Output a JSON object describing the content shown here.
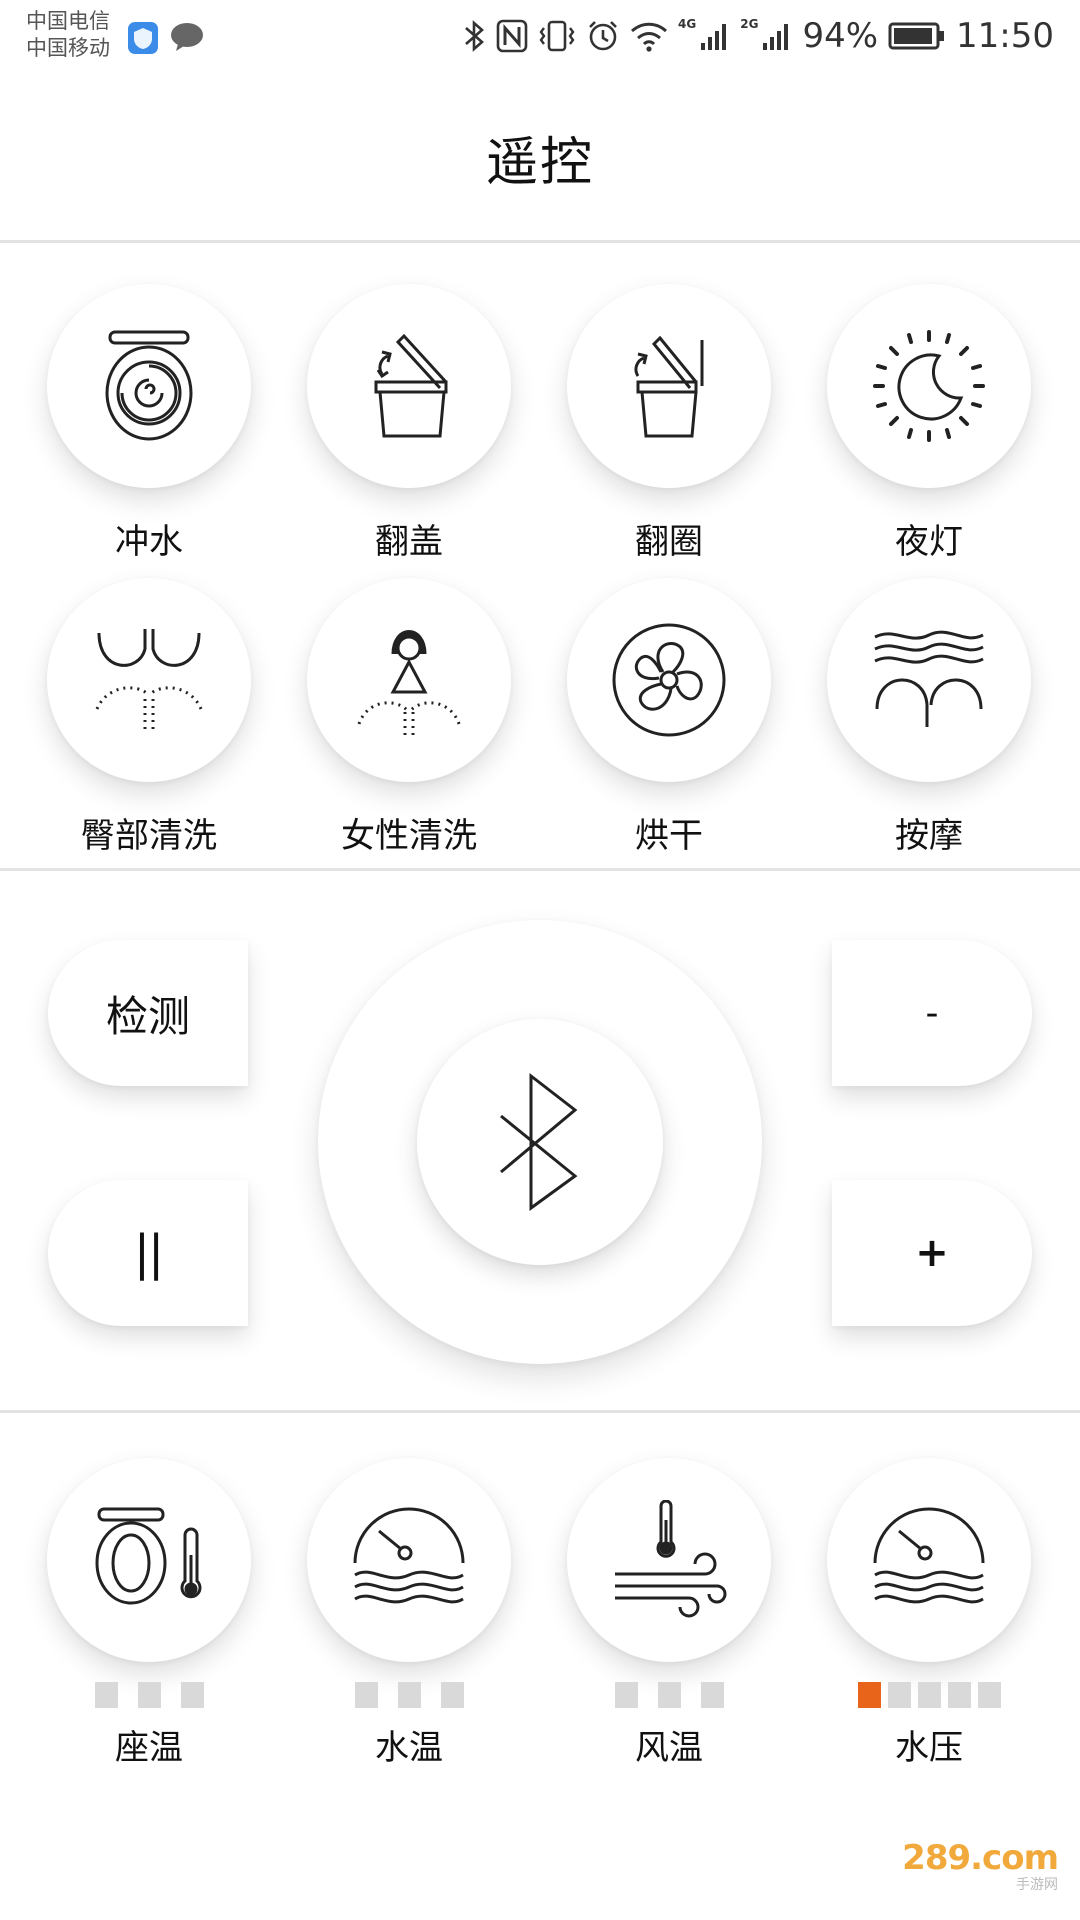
{
  "status_bar": {
    "carrier_1": "中国电信",
    "carrier_2": "中国移动",
    "net_4g": "4G",
    "net_2g": "2G",
    "battery": "94%",
    "time": "11:50"
  },
  "header": {
    "title": "遥控"
  },
  "functions": [
    {
      "label": "冲水",
      "icon": "flush-icon"
    },
    {
      "label": "翻盖",
      "icon": "lid-flip-icon"
    },
    {
      "label": "翻圈",
      "icon": "seat-ring-flip-icon"
    },
    {
      "label": "夜灯",
      "icon": "night-light-icon"
    },
    {
      "label": "臀部清洗",
      "icon": "rear-wash-icon"
    },
    {
      "label": "女性清洗",
      "icon": "feminine-wash-icon"
    },
    {
      "label": "烘干",
      "icon": "fan-dry-icon"
    },
    {
      "label": "按摩",
      "icon": "massage-icon"
    }
  ],
  "controls": {
    "detect_label": "检测",
    "pause_label": "||",
    "minus_label": "-",
    "plus_label": "+",
    "center_icon": "bluetooth-icon"
  },
  "settings": [
    {
      "label": "座温",
      "icon": "seat-temperature-icon",
      "level": 0,
      "segments": 3
    },
    {
      "label": "水温",
      "icon": "water-temperature-icon",
      "level": 0,
      "segments": 3
    },
    {
      "label": "风温",
      "icon": "air-temperature-icon",
      "level": 0,
      "segments": 3
    },
    {
      "label": "水压",
      "icon": "water-pressure-icon",
      "level": 1,
      "segments": 5
    }
  ],
  "colors": {
    "level_active": "#e8641b",
    "level_inactive": "#d9d9d9"
  },
  "watermark": {
    "main": "289.com",
    "sub": "手游网"
  }
}
